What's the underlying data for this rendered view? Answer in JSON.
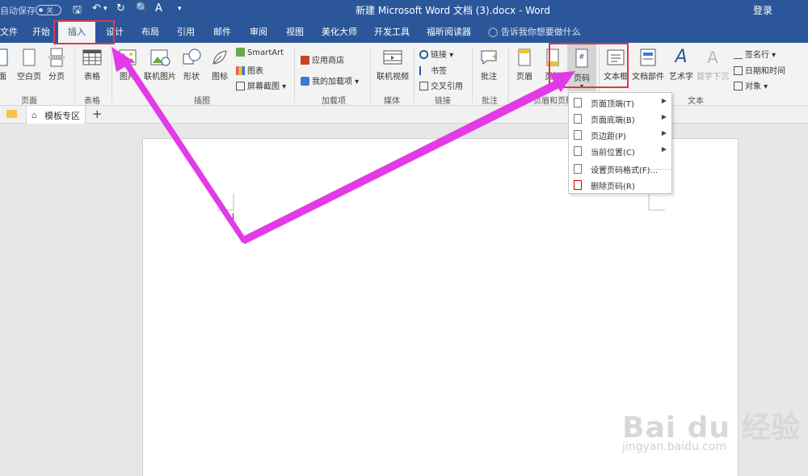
{
  "titlebar": {
    "autosave_label": "自动保存",
    "autosave_state": "关",
    "doc_title": "新建 Microsoft Word 文档 (3).docx  -  Word",
    "login_label": "登录"
  },
  "tabs": [
    "文件",
    "开始",
    "插入",
    "设计",
    "布局",
    "引用",
    "邮件",
    "审阅",
    "视图",
    "美化大师",
    "开发工具",
    "福昕阅读器"
  ],
  "active_tab": "插入",
  "tell_me": "告诉我你想要做什么",
  "ribbon": {
    "pages": {
      "cover": "面",
      "blank": "空白页",
      "break": "分页",
      "group": "页面"
    },
    "tables": {
      "table": "表格",
      "group": "表格"
    },
    "illustrations": {
      "picture": "图片",
      "online_picture": "联机图片",
      "shapes": "形状",
      "icons": "图标",
      "smartart": "SmartArt",
      "chart": "图表",
      "screenshot": "屏幕截图",
      "group": "插图"
    },
    "addins": {
      "store": "应用商店",
      "my_addins": "我的加载项",
      "group": "加载项"
    },
    "media": {
      "online_video": "联机视频",
      "group": "媒体"
    },
    "links": {
      "link": "链接",
      "bookmark": "书签",
      "cross_ref": "交叉引用",
      "group": "链接"
    },
    "comments": {
      "comment": "批注",
      "group": "批注"
    },
    "header_footer": {
      "header": "页眉",
      "footer": "页脚",
      "page_number": "页码",
      "group": "页眉和页脚"
    },
    "text": {
      "textbox": "文本框",
      "quick_parts": "文档部件",
      "wordart": "艺术字",
      "dropcap": "首字下沉",
      "signature": "签名行",
      "datetime": "日期和时间",
      "object": "对象",
      "group": "文本"
    }
  },
  "doc_tabs": {
    "template_zone": "模板专区",
    "add": "+"
  },
  "page_number_menu": [
    {
      "label": "页面顶端(T)",
      "submenu": true
    },
    {
      "label": "页面底端(B)",
      "submenu": true
    },
    {
      "label": "页边距(P)",
      "submenu": true
    },
    {
      "label": "当前位置(C)",
      "submenu": true
    },
    {
      "label": "设置页码格式(F)...",
      "submenu": false
    },
    {
      "label": "删除页码(R)",
      "submenu": false
    }
  ],
  "watermark": {
    "brand": "Bai du 经验",
    "url": "jingyan.baidu.com"
  },
  "colors": {
    "word_blue": "#2b579a",
    "highlight_red": "#e2364b",
    "arrow_magenta": "#e33ae8"
  }
}
